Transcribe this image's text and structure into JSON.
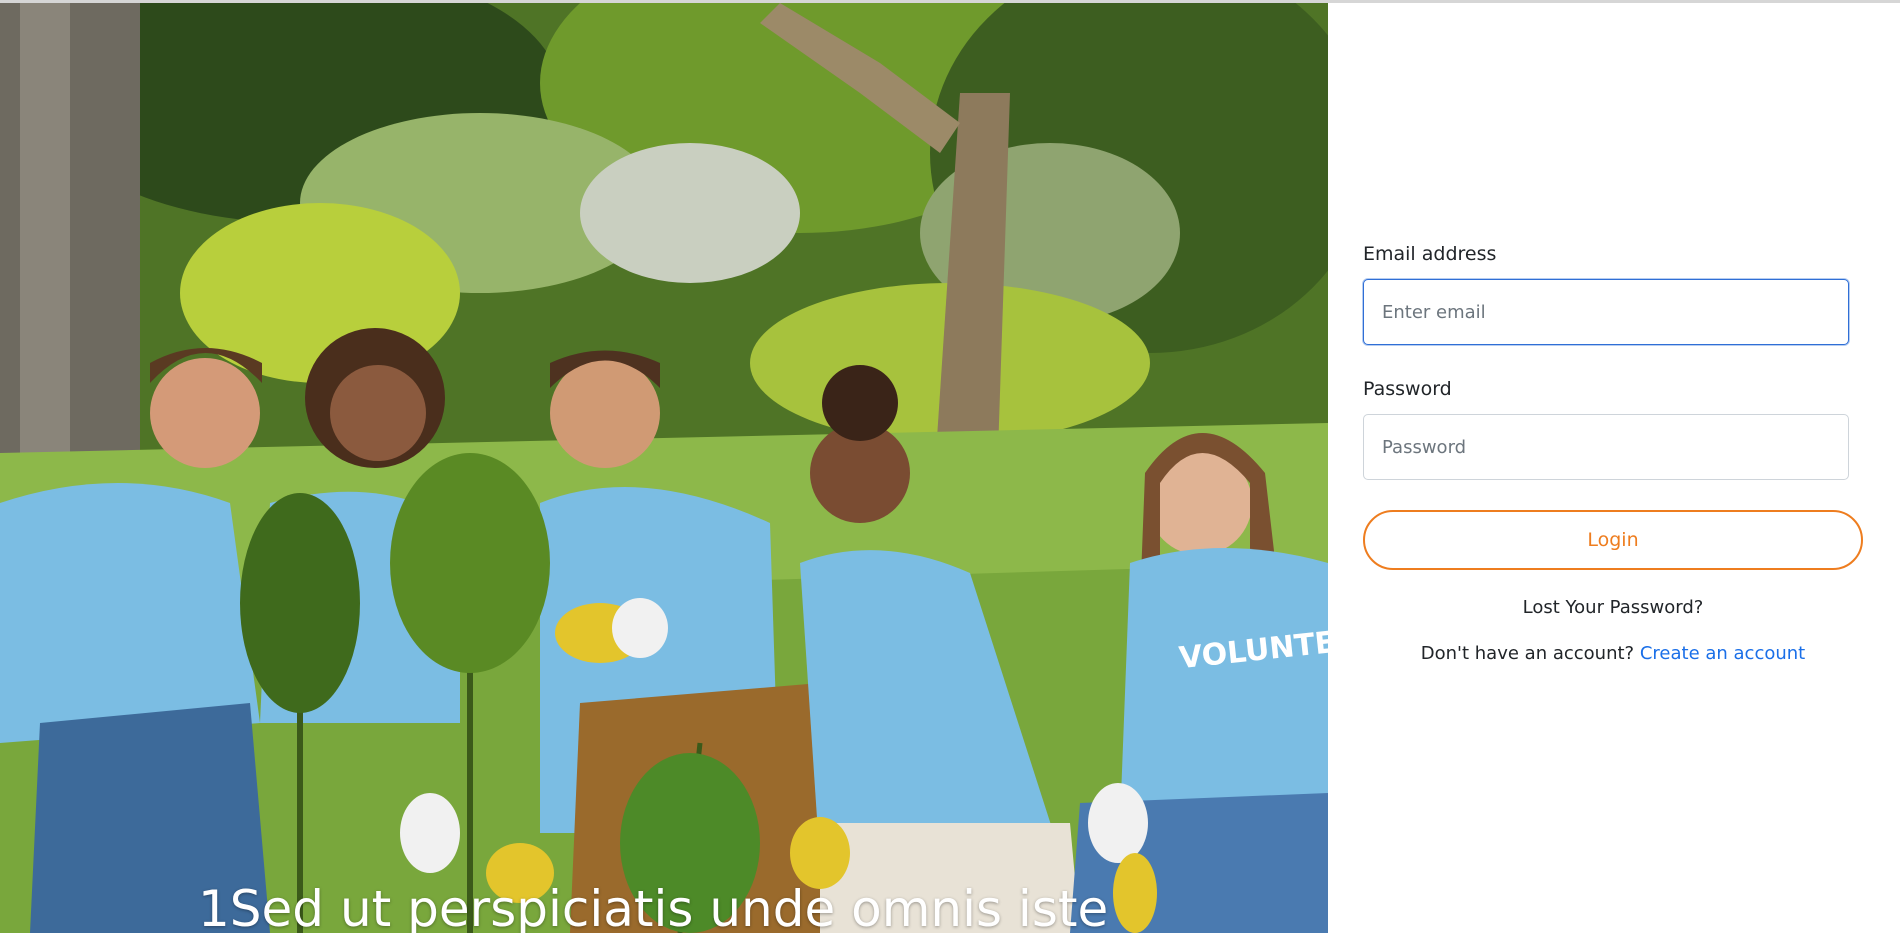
{
  "hero": {
    "caption": "1Sed ut perspiciatis unde omnis iste",
    "shirt_print": "VOLUNTEER"
  },
  "login": {
    "email": {
      "label": "Email address",
      "placeholder": "Enter email",
      "value": ""
    },
    "password": {
      "label": "Password",
      "placeholder": "Password",
      "value": ""
    },
    "login_button": "Login",
    "lost_password": "Lost Your Password?",
    "no_account_text": "Don't have an account?",
    "create_account_link": "Create an account"
  },
  "colors": {
    "accent_orange": "#ee7d1f",
    "link_blue": "#1a6fe8",
    "focus_border": "#2f6fd6",
    "text": "#212529"
  }
}
